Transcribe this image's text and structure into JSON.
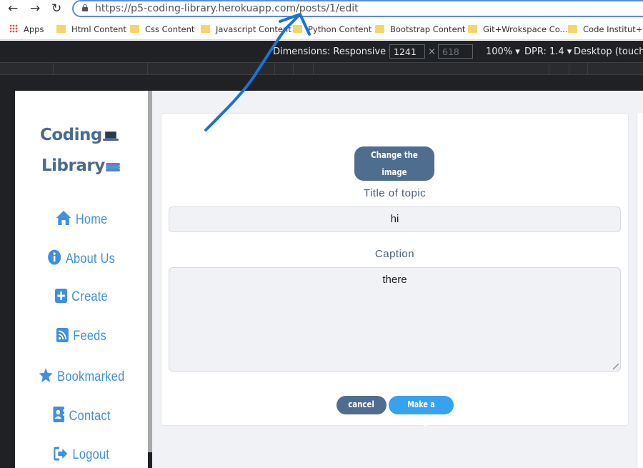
{
  "browser": {
    "url_host": "https://p5-coding-library.herokuapp.com",
    "url_path": "/posts/1/edit",
    "bookmarks": [
      "Apps",
      "Html Content",
      "Css Content",
      "Javascript Content",
      "Python Content",
      "Bootstrap Content",
      "Git+Wrokspace Co...",
      "Code Institut+Ext"
    ]
  },
  "devtools": {
    "dimensions": "Dimensions: Responsive",
    "width": "1241",
    "height": "618",
    "zoom": "100%",
    "dpr": "DPR: 1.4",
    "device": "Desktop (touch)"
  },
  "sidebar": {
    "logo_line1": "Coding",
    "logo_line2": "Library",
    "items": [
      {
        "label": "Home",
        "icon": "home-icon"
      },
      {
        "label": "About Us",
        "icon": "info-circle-icon"
      },
      {
        "label": "Create",
        "icon": "plus-square-icon"
      },
      {
        "label": "Feeds",
        "icon": "rss-square-icon"
      },
      {
        "label": "Bookmarked",
        "icon": "star-icon"
      },
      {
        "label": "Contact",
        "icon": "contact-card-icon"
      },
      {
        "label": "Logout",
        "icon": "sign-out-icon"
      }
    ]
  },
  "form": {
    "change_image_label": "Change the image",
    "title_label": "Title of topic",
    "title_value": "hi",
    "caption_label": "Caption",
    "caption_value": "there",
    "cancel_label": "cancel",
    "submit_label": "Make a changes"
  },
  "colors": {
    "accent": "#3f8fe0",
    "slate_button": "#4f6d8f",
    "submit_button": "#36a2f0",
    "annotation_arrow": "#1a73d6"
  }
}
